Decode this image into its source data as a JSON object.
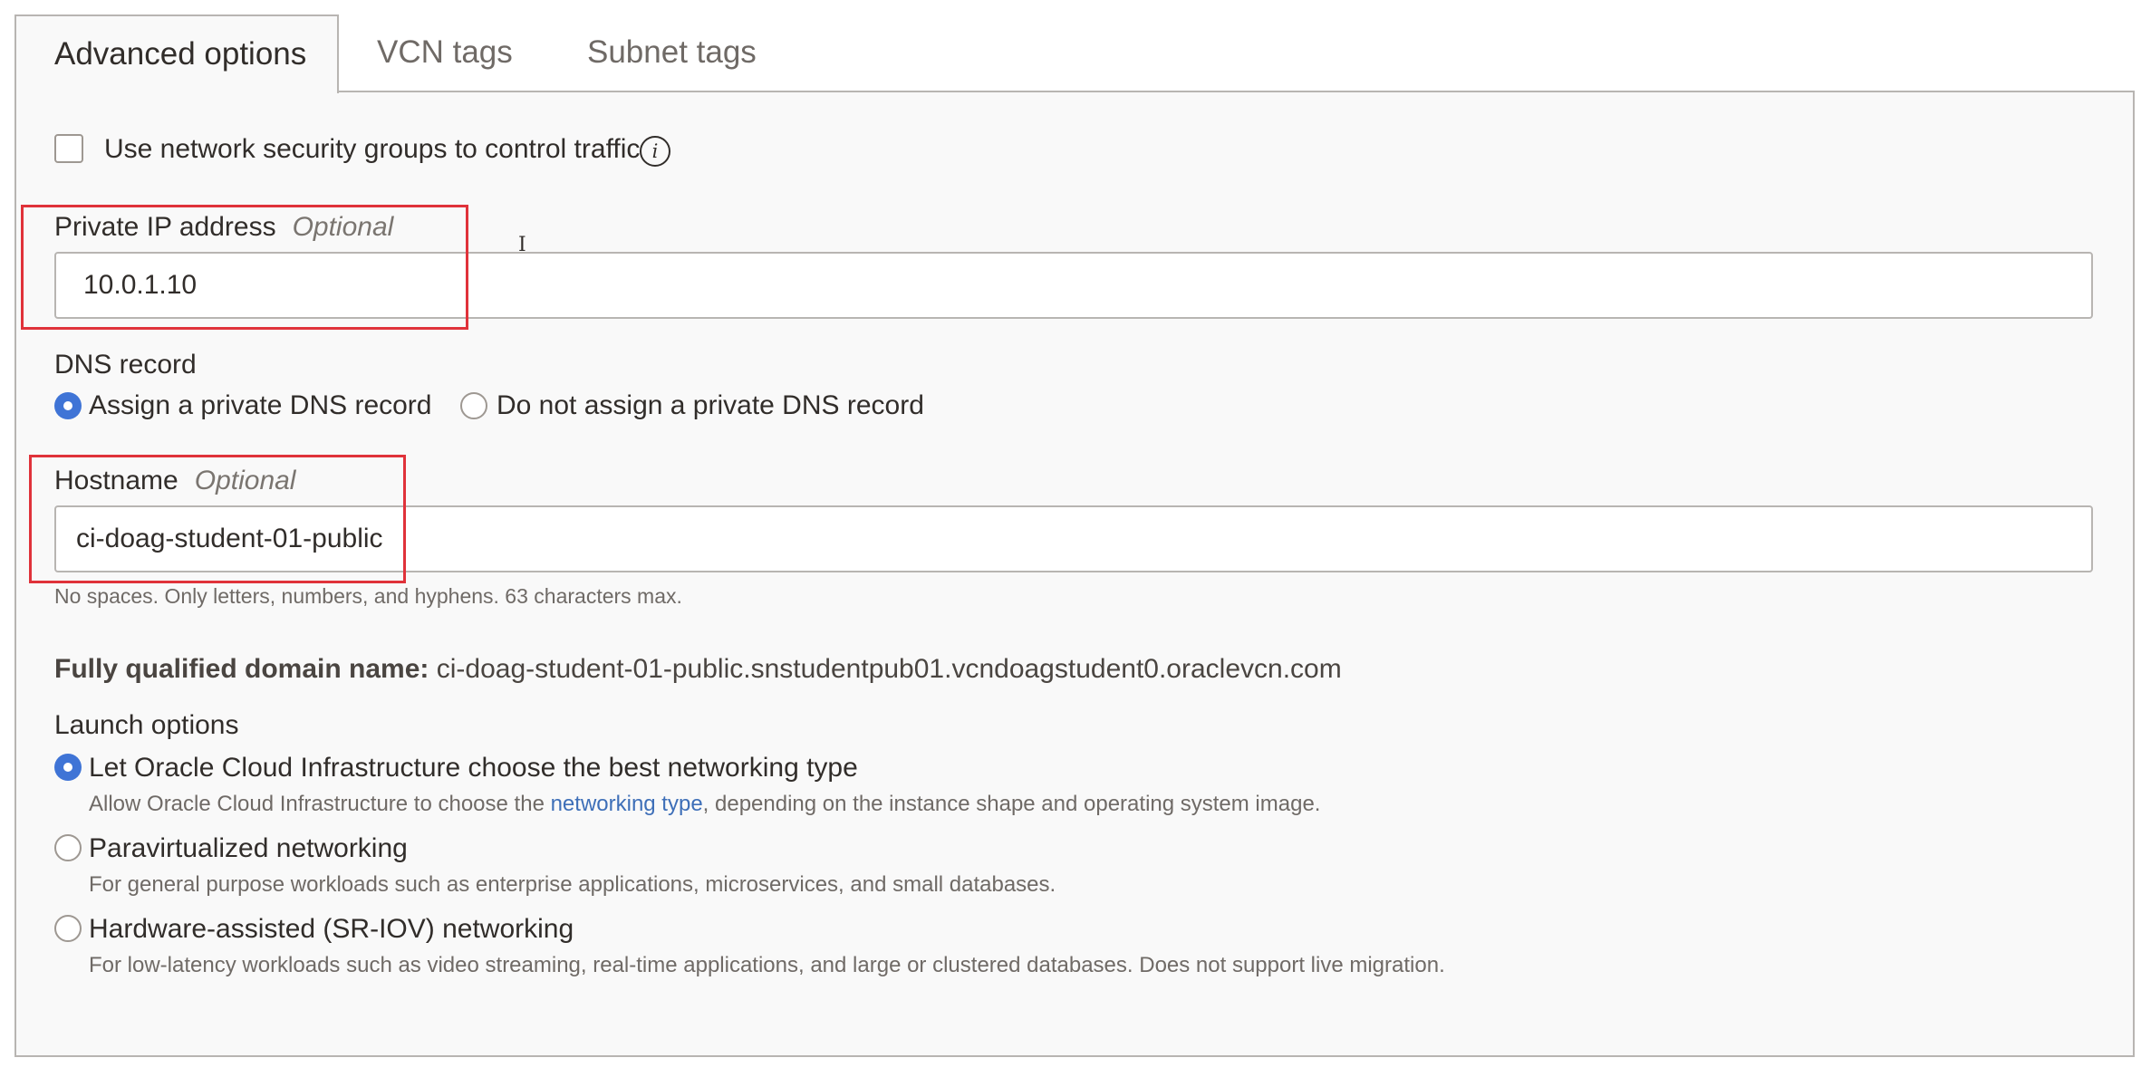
{
  "tabs": [
    {
      "label": "Advanced options",
      "active": true
    },
    {
      "label": "VCN tags",
      "active": false
    },
    {
      "label": "Subnet tags",
      "active": false
    }
  ],
  "nsg": {
    "label": "Use network security groups to control traffic",
    "checked": false,
    "info_icon": "info-icon"
  },
  "private_ip": {
    "label": "Private IP address",
    "optional": "Optional",
    "value": "10.0.1.10"
  },
  "dns_record": {
    "label": "DNS record",
    "options": [
      {
        "label": "Assign a private DNS record",
        "selected": true
      },
      {
        "label": "Do not assign a private DNS record",
        "selected": false
      }
    ]
  },
  "hostname": {
    "label": "Hostname",
    "optional": "Optional",
    "value": "ci-doag-student-01-public",
    "help": "No spaces. Only letters, numbers, and hyphens. 63 characters max."
  },
  "fqdn": {
    "label": "Fully qualified domain name:",
    "value": "ci-doag-student-01-public.snstudentpub01.vcndoagstudent0.oraclevcn.com"
  },
  "launch_options": {
    "label": "Launch options",
    "options": [
      {
        "label": "Let Oracle Cloud Infrastructure choose the best networking type",
        "selected": true,
        "desc_before": "Allow Oracle Cloud Infrastructure to choose the ",
        "desc_link": "networking type",
        "desc_after": ", depending on the instance shape and operating system image."
      },
      {
        "label": "Paravirtualized networking",
        "selected": false,
        "desc": "For general purpose workloads such as enterprise applications, microservices, and small databases."
      },
      {
        "label": "Hardware-assisted (SR-IOV) networking",
        "selected": false,
        "desc": "For low-latency workloads such as video streaming, real-time applications, and large or clustered databases. Does not support live migration."
      }
    ]
  },
  "colors": {
    "accent_blue": "#3f74d6",
    "link_blue": "#3e6fb8",
    "highlight_red": "#e0323a"
  },
  "cursor_glyph": "I"
}
